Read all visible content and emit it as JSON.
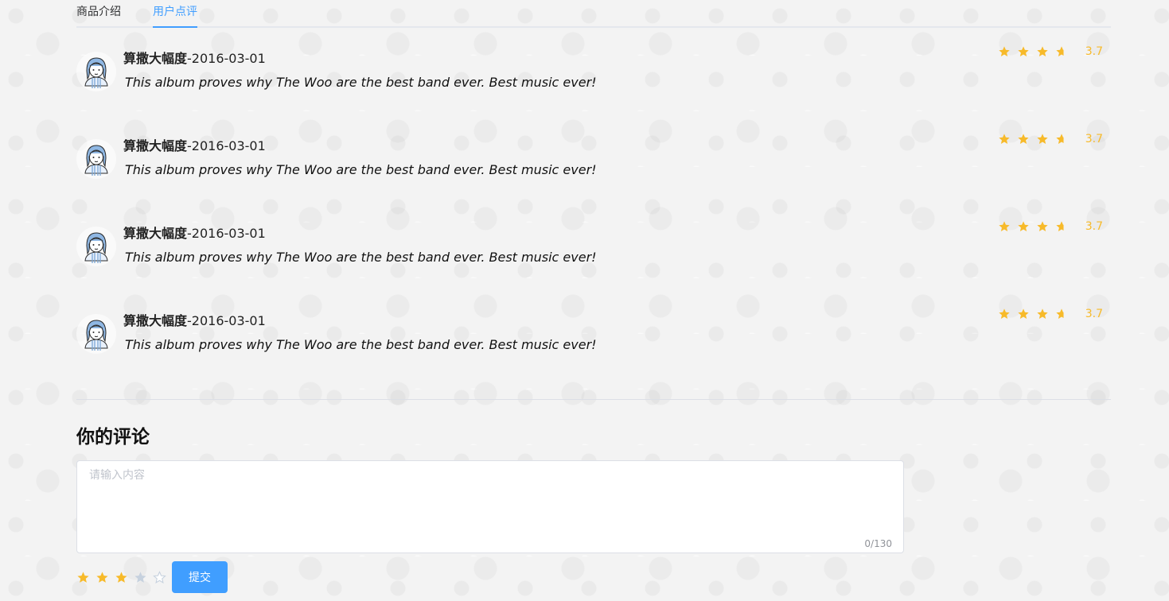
{
  "tabs": [
    {
      "label": "商品介绍",
      "active": false
    },
    {
      "label": "用户点评",
      "active": true
    }
  ],
  "reviews": [
    {
      "user": "算撒大幅度",
      "sep": "-",
      "date": "2016-03-01",
      "text": "This album proves why The Woo are the best band ever. Best music ever!",
      "rating": 3.7,
      "score": "3.7"
    },
    {
      "user": "算撒大幅度",
      "sep": "-",
      "date": "2016-03-01",
      "text": "This album proves why The Woo are the best band ever. Best music ever!",
      "rating": 3.7,
      "score": "3.7"
    },
    {
      "user": "算撒大幅度",
      "sep": "-",
      "date": "2016-03-01",
      "text": "This album proves why The Woo are the best band ever. Best music ever!",
      "rating": 3.7,
      "score": "3.7"
    },
    {
      "user": "算撒大幅度",
      "sep": "-",
      "date": "2016-03-01",
      "text": "This album proves why The Woo are the best band ever. Best music ever!",
      "rating": 3.7,
      "score": "3.7"
    }
  ],
  "comment": {
    "title": "你的评论",
    "placeholder": "请输入内容",
    "value": "",
    "counter": "0/130",
    "my_rating": 3,
    "submit_label": "提交"
  },
  "colors": {
    "accent": "#409eff",
    "star_on": "#f7ba2a",
    "star_off": "#c6d1de"
  },
  "icons": {
    "avatar": "user-avatar-icon",
    "star": "star-icon"
  }
}
